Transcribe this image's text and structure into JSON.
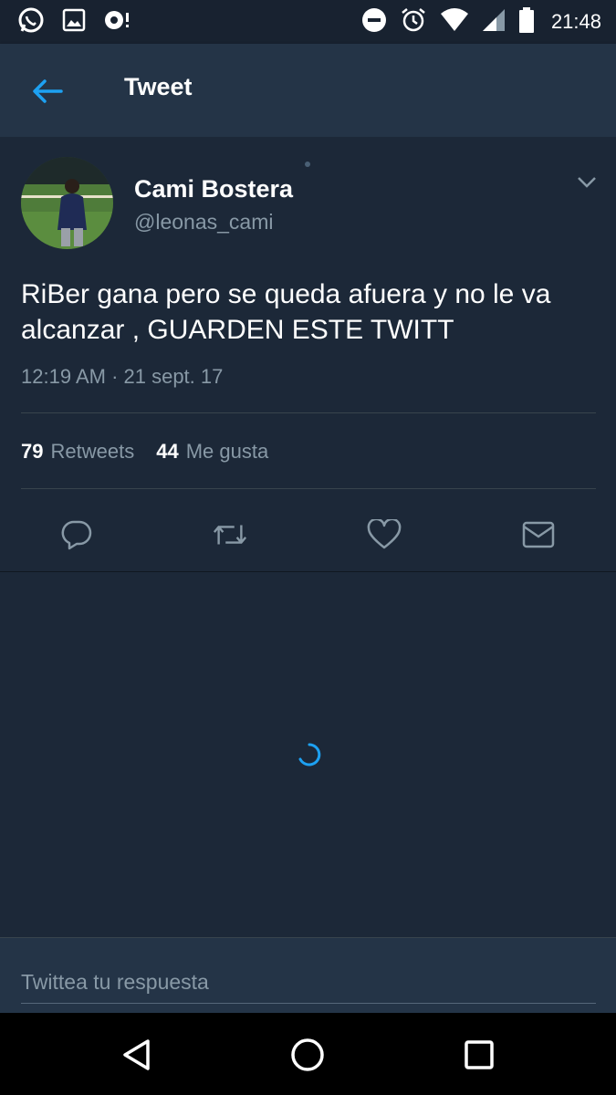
{
  "status_bar": {
    "time": "21:48",
    "left_icons": [
      "whatsapp-icon",
      "image-icon",
      "sync-icon"
    ],
    "right_icons": [
      "do-not-disturb-icon",
      "alarm-icon",
      "wifi-icon",
      "signal-icon",
      "battery-icon"
    ]
  },
  "app_bar": {
    "title": "Tweet",
    "back_icon": "arrow-left-icon",
    "accent_color": "#1da1f2"
  },
  "tweet": {
    "author_name": "Cami Bostera",
    "author_handle": "@leonas_cami",
    "text": "RiBer gana pero se queda afuera y no le va alcanzar , GUARDEN ESTE TWITT",
    "timestamp": "12:19 AM · 21 sept. 17",
    "retweets_count": "79",
    "retweets_label": "Retweets",
    "likes_count": "44",
    "likes_label": "Me gusta"
  },
  "actions": [
    "reply-icon",
    "retweet-icon",
    "like-icon",
    "message-icon"
  ],
  "reply": {
    "placeholder": "Twittea tu respuesta"
  },
  "nav": [
    "back-triangle-icon",
    "home-circle-icon",
    "recents-square-icon"
  ]
}
